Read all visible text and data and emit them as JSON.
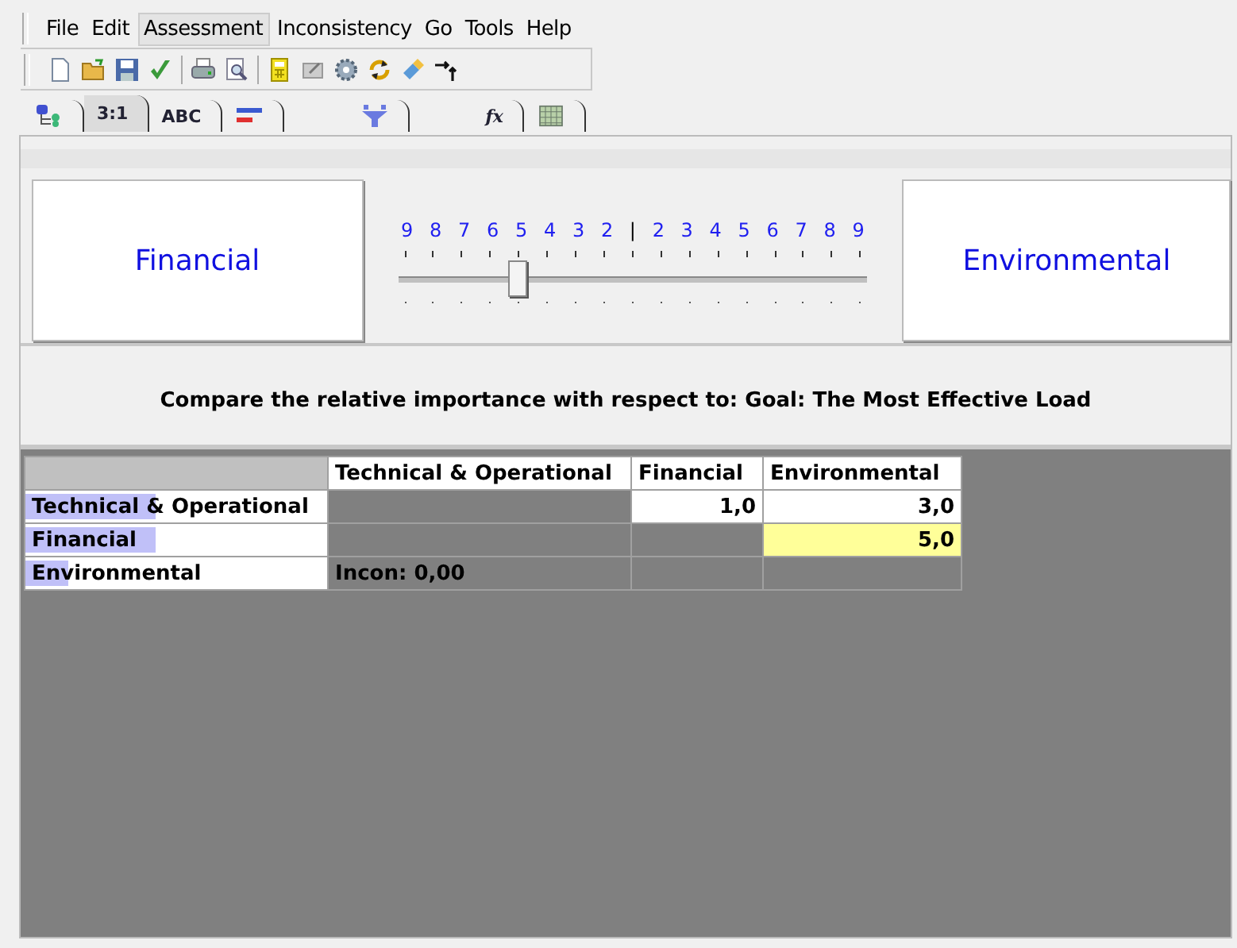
{
  "menu": [
    {
      "label": "File",
      "selected": false
    },
    {
      "label": "Edit",
      "selected": false
    },
    {
      "label": "Assessment",
      "selected": true
    },
    {
      "label": "Inconsistency",
      "selected": false
    },
    {
      "label": "Go",
      "selected": false
    },
    {
      "label": "Tools",
      "selected": false
    },
    {
      "label": "Help",
      "selected": false
    }
  ],
  "toolbar": [
    {
      "kind": "new"
    },
    {
      "kind": "open"
    },
    {
      "kind": "save"
    },
    {
      "kind": "check"
    },
    {
      "kind": "sep"
    },
    {
      "kind": "print"
    },
    {
      "kind": "preview"
    },
    {
      "kind": "sep"
    },
    {
      "kind": "calc"
    },
    {
      "kind": "card"
    },
    {
      "kind": "gear"
    },
    {
      "kind": "refresh"
    },
    {
      "kind": "eraser"
    },
    {
      "kind": "arrows"
    }
  ],
  "tabs": [
    {
      "kind": "tree",
      "selected": false
    },
    {
      "kind": "text",
      "label": "3:1",
      "selected": true
    },
    {
      "kind": "text",
      "label": "ABC",
      "selected": false
    },
    {
      "kind": "bars",
      "selected": false
    },
    {
      "kind": "funnel",
      "selected": false
    },
    {
      "kind": "text",
      "label": "fx",
      "selected": false
    },
    {
      "kind": "grid",
      "selected": false
    }
  ],
  "comparison": {
    "left": "Financial",
    "right": "Environmental",
    "scale": [
      "9",
      "8",
      "7",
      "6",
      "5",
      "4",
      "3",
      "2",
      "|",
      "2",
      "3",
      "4",
      "5",
      "6",
      "7",
      "8",
      "9"
    ],
    "level": 0.25
  },
  "prompt": "Compare the relative importance with respect to: Goal: The Most Effective Load",
  "table": {
    "columns": [
      "Technical & Operational",
      "Financial",
      "Environmental"
    ],
    "rows": [
      {
        "label": "Technical & Operational",
        "level": 0.43,
        "cells": [
          {
            "kind": "blank"
          },
          {
            "kind": "value",
            "text": "1,0",
            "selected": false
          },
          {
            "kind": "value",
            "text": "3,0",
            "selected": false
          }
        ]
      },
      {
        "label": "Financial",
        "level": 0.43,
        "cells": [
          {
            "kind": "blank"
          },
          {
            "kind": "blank"
          },
          {
            "kind": "value",
            "text": "5,0",
            "selected": true
          }
        ]
      },
      {
        "label": "Environmental",
        "level": 0.14,
        "cells": [
          {
            "kind": "note",
            "text": "Incon: 0,00"
          },
          {
            "kind": "blank"
          },
          {
            "kind": "blank"
          }
        ]
      }
    ]
  }
}
